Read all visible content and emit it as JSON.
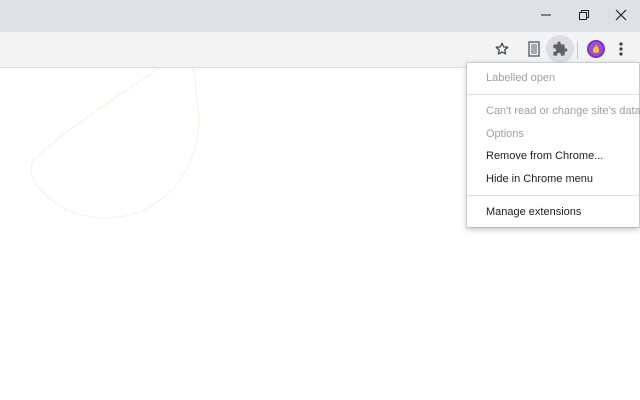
{
  "window_controls": {
    "minimize_icon": "minimize-icon",
    "restore_icon": "restore-icon",
    "close_icon": "close-icon"
  },
  "toolbar": {
    "icons": [
      "star-icon",
      "document-extension-icon",
      "puzzle-icon",
      "profile-avatar",
      "more-vert-icon"
    ]
  },
  "context_menu": {
    "header": "Labelled open",
    "items": [
      {
        "label": "Can't read or change site's data",
        "enabled": false
      },
      {
        "label": "Options",
        "enabled": false
      },
      {
        "label": "Remove from Chrome...",
        "enabled": true
      },
      {
        "label": "Hide in Chrome menu",
        "enabled": true
      }
    ],
    "footer": "Manage extensions"
  },
  "colors": {
    "titlebar": "#dee1e6",
    "toolbar": "#f1f3f4",
    "menu_text": "#202124",
    "menu_disabled_text": "#9aa0a6",
    "avatar": "#9c4fd3"
  }
}
